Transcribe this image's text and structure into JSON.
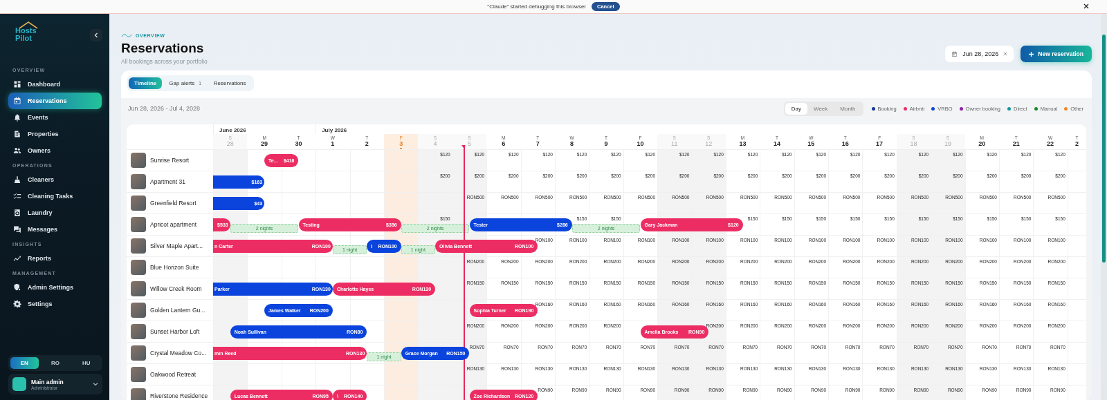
{
  "debug_banner": {
    "message": "\"Claude\" started debugging this browser",
    "action": "Cancel"
  },
  "sidebar": {
    "logo": [
      "Hosts",
      "Pilot"
    ],
    "sections": [
      {
        "title": "OVERVIEW",
        "items": [
          {
            "label": "Dashboard",
            "kind": "dashboard",
            "selected": false
          },
          {
            "label": "Reservations",
            "kind": "calendar",
            "selected": true
          },
          {
            "label": "Events",
            "kind": "bell",
            "selected": false
          },
          {
            "label": "Properties",
            "kind": "building",
            "selected": false
          },
          {
            "label": "Owners",
            "kind": "people",
            "selected": false
          }
        ]
      },
      {
        "title": "OPERATIONS",
        "items": [
          {
            "label": "Cleaners",
            "kind": "cleaner",
            "selected": false
          },
          {
            "label": "Cleaning Tasks",
            "kind": "tasks",
            "selected": false
          },
          {
            "label": "Laundry",
            "kind": "laundry",
            "selected": false
          },
          {
            "label": "Messages",
            "kind": "chat",
            "selected": false
          }
        ]
      },
      {
        "title": "INSIGHTS",
        "items": [
          {
            "label": "Reports",
            "kind": "chart",
            "selected": false
          }
        ]
      },
      {
        "title": "MANAGEMENT",
        "items": [
          {
            "label": "Admin Settings",
            "kind": "admin",
            "selected": false
          },
          {
            "label": "Settings",
            "kind": "gear",
            "selected": false
          }
        ]
      }
    ],
    "languages": [
      {
        "code": "EN",
        "selected": true
      },
      {
        "code": "RO",
        "selected": false
      },
      {
        "code": "HU",
        "selected": false
      }
    ],
    "user": {
      "name": "Main admin",
      "role": "Administrator"
    }
  },
  "header": {
    "eyebrow": "OVERVIEW",
    "title": "Reservations",
    "subtitle": "All bookings across your portfolio",
    "date_filter": "Jun 28, 2026",
    "new_button": "New reservation"
  },
  "tabs": [
    {
      "label": "Timeline",
      "selected": true
    },
    {
      "label": "Gap alerts",
      "badge": "1",
      "selected": false
    },
    {
      "label": "Reservations",
      "selected": false
    }
  ],
  "range": "Jun 28, 2026 - Jul 4, 2028",
  "views": [
    {
      "label": "Day",
      "selected": true
    },
    {
      "label": "Week",
      "selected": false
    },
    {
      "label": "Month",
      "selected": false
    }
  ],
  "legend": [
    {
      "label": "Booking",
      "color": "#1a3597"
    },
    {
      "label": "Airbnb",
      "color": "#ec2d63"
    },
    {
      "label": "VRBO",
      "color": "#0b44dd"
    },
    {
      "label": "Owner booking",
      "color": "#8e1fa8"
    },
    {
      "label": "Direct",
      "color": "#13969a"
    },
    {
      "label": "Manual",
      "color": "#1c8a2a"
    },
    {
      "label": "Other",
      "color": "#ef8a25"
    }
  ],
  "timeline": {
    "days": [
      {
        "month": "June 2026",
        "weekday": "S",
        "day": "28",
        "weekend": true,
        "today": false,
        "now": false
      },
      {
        "weekday": "M",
        "day": "29",
        "weekend": false,
        "today": false,
        "now": false
      },
      {
        "weekday": "T",
        "day": "30",
        "weekend": false,
        "today": false,
        "now": false
      },
      {
        "month": "July 2026",
        "weekday": "W",
        "day": "1",
        "weekend": false,
        "today": false,
        "now": false
      },
      {
        "weekday": "T",
        "day": "2",
        "weekend": false,
        "today": false,
        "now": false
      },
      {
        "weekday": "F",
        "day": "3",
        "weekend": false,
        "today": true,
        "now": false
      },
      {
        "weekday": "S",
        "day": "4",
        "weekend": true,
        "today": false,
        "now": false
      },
      {
        "weekday": "S",
        "day": "5",
        "weekend": true,
        "today": false,
        "now": true
      },
      {
        "weekday": "M",
        "day": "6",
        "weekend": false,
        "today": false,
        "now": false
      },
      {
        "weekday": "T",
        "day": "7",
        "weekend": false,
        "today": false,
        "now": false
      },
      {
        "weekday": "W",
        "day": "8",
        "weekend": false,
        "today": false,
        "now": false
      },
      {
        "weekday": "T",
        "day": "9",
        "weekend": false,
        "today": false,
        "now": false
      },
      {
        "weekday": "F",
        "day": "10",
        "weekend": false,
        "today": false,
        "now": false
      },
      {
        "weekday": "S",
        "day": "11",
        "weekend": true,
        "today": false,
        "now": false
      },
      {
        "weekday": "S",
        "day": "12",
        "weekend": true,
        "today": false,
        "now": false
      },
      {
        "weekday": "M",
        "day": "13",
        "weekend": false,
        "today": false,
        "now": false
      },
      {
        "weekday": "T",
        "day": "14",
        "weekend": false,
        "today": false,
        "now": false
      },
      {
        "weekday": "W",
        "day": "15",
        "weekend": false,
        "today": false,
        "now": false
      },
      {
        "weekday": "T",
        "day": "16",
        "weekend": false,
        "today": false,
        "now": false
      },
      {
        "weekday": "F",
        "day": "17",
        "weekend": false,
        "today": false,
        "now": false
      },
      {
        "weekday": "S",
        "day": "18",
        "weekend": true,
        "today": false,
        "now": false
      },
      {
        "weekday": "S",
        "day": "19",
        "weekend": true,
        "today": false,
        "now": false
      },
      {
        "weekday": "M",
        "day": "20",
        "weekend": false,
        "today": false,
        "now": false
      },
      {
        "weekday": "T",
        "day": "21",
        "weekend": false,
        "today": false,
        "now": false
      },
      {
        "weekday": "W",
        "day": "22",
        "weekend": false,
        "today": false,
        "now": false
      },
      {
        "weekday": "T",
        "day": "2",
        "weekend": false,
        "today": false,
        "now": false
      }
    ],
    "rows": [
      {
        "name": "Sunrise Resort",
        "cells": [
          {
            "kind": "free"
          },
          {
            "kind": "night",
            "booking": {
              "guest": "Te...",
              "amount": "$416",
              "color": "#ec2d63",
              "from_earlier": false
            }
          },
          {
            "kind": "free"
          },
          {
            "kind": "free"
          },
          {
            "kind": "free"
          },
          {
            "kind": "free"
          },
          {
            "kind": "rate",
            "text": "$120"
          },
          {
            "kind": "rate",
            "text": "$120"
          },
          {
            "kind": "rate",
            "text": "$120"
          },
          {
            "kind": "rate",
            "text": "$120"
          },
          {
            "kind": "rate",
            "text": "$120"
          },
          {
            "kind": "rate",
            "text": "$120"
          },
          {
            "kind": "rate",
            "text": "$120"
          },
          {
            "kind": "rate",
            "text": "$120"
          },
          {
            "kind": "rate",
            "text": "$120"
          },
          {
            "kind": "rate",
            "text": "$120"
          },
          {
            "kind": "rate",
            "text": "$120"
          },
          {
            "kind": "rate",
            "text": "$120"
          },
          {
            "kind": "rate",
            "text": "$120"
          },
          {
            "kind": "rate",
            "text": "$120"
          },
          {
            "kind": "rate",
            "text": "$120"
          },
          {
            "kind": "rate",
            "text": "$120"
          },
          {
            "kind": "rate",
            "text": "$120"
          },
          {
            "kind": "rate",
            "text": "$120"
          },
          {
            "kind": "rate",
            "text": "$120"
          },
          {
            "kind": "free"
          }
        ]
      },
      {
        "name": "Apartment 31",
        "cells": [
          {
            "kind": "night",
            "booking": {
              "amount": "$163",
              "color": "#0b44dd",
              "from_earlier": true
            }
          },
          {
            "kind": "free"
          },
          {
            "kind": "free"
          },
          {
            "kind": "free"
          },
          {
            "kind": "free"
          },
          {
            "kind": "free"
          },
          {
            "kind": "rate",
            "text": "$200"
          },
          {
            "kind": "rate",
            "text": "$200"
          },
          {
            "kind": "rate",
            "text": "$200"
          },
          {
            "kind": "rate",
            "text": "$200"
          },
          {
            "kind": "rate",
            "text": "$200"
          },
          {
            "kind": "rate",
            "text": "$200"
          },
          {
            "kind": "rate",
            "text": "$200"
          },
          {
            "kind": "rate",
            "text": "$200"
          },
          {
            "kind": "rate",
            "text": "$200"
          },
          {
            "kind": "rate",
            "text": "$200"
          },
          {
            "kind": "rate",
            "text": "$200"
          },
          {
            "kind": "rate",
            "text": "$200"
          },
          {
            "kind": "rate",
            "text": "$200"
          },
          {
            "kind": "rate",
            "text": "$200"
          },
          {
            "kind": "rate",
            "text": "$200"
          },
          {
            "kind": "rate",
            "text": "$200"
          },
          {
            "kind": "rate",
            "text": "$200"
          },
          {
            "kind": "rate",
            "text": "$200"
          },
          {
            "kind": "rate",
            "text": "$200"
          },
          {
            "kind": "free"
          }
        ]
      },
      {
        "name": "Greenfield Resort",
        "cells": [
          {
            "kind": "night",
            "booking": {
              "amount": "$43",
              "color": "#0b44dd",
              "from_earlier": true
            }
          },
          {
            "kind": "free"
          },
          {
            "kind": "free"
          },
          {
            "kind": "free"
          },
          {
            "kind": "free"
          },
          {
            "kind": "free"
          },
          {
            "kind": "free"
          },
          {
            "kind": "rate",
            "text": "RON500"
          },
          {
            "kind": "rate",
            "text": "RON500"
          },
          {
            "kind": "rate",
            "text": "RON500"
          },
          {
            "kind": "rate",
            "text": "RON500"
          },
          {
            "kind": "rate",
            "text": "RON500"
          },
          {
            "kind": "rate",
            "text": "RON500"
          },
          {
            "kind": "rate",
            "text": "RON500"
          },
          {
            "kind": "rate",
            "text": "RON500"
          },
          {
            "kind": "rate",
            "text": "RON500"
          },
          {
            "kind": "rate",
            "text": "RON500"
          },
          {
            "kind": "rate",
            "text": "RON500"
          },
          {
            "kind": "rate",
            "text": "RON500"
          },
          {
            "kind": "rate",
            "text": "RON500"
          },
          {
            "kind": "rate",
            "text": "RON500"
          },
          {
            "kind": "rate",
            "text": "RON500"
          },
          {
            "kind": "rate",
            "text": "RON500"
          },
          {
            "kind": "rate",
            "text": "RON500"
          },
          {
            "kind": "rate",
            "text": "RON500"
          },
          {
            "kind": "free"
          }
        ]
      },
      {
        "name": "Apricot apartment",
        "cells": [
          {
            "kind": "free",
            "booking": {
              "amount": "$533",
              "color": "#ec2d63",
              "from_earlier": true
            },
            "gap": {
              "label": "2 nights"
            }
          },
          {
            "kind": "free"
          },
          {
            "kind": "night",
            "booking": {
              "guest": "Testing",
              "amount": "$356",
              "color": "#ec2d63",
              "from_earlier": false
            }
          },
          {
            "kind": "night"
          },
          {
            "kind": "night"
          },
          {
            "kind": "free",
            "gap": {
              "label": "2 nights"
            }
          },
          {
            "kind": "rate",
            "text": "$150"
          },
          {
            "kind": "night",
            "booking": {
              "guest": "Tester",
              "amount": "$286",
              "color": "#0b44dd",
              "from_earlier": false
            }
          },
          {
            "kind": "night"
          },
          {
            "kind": "night"
          },
          {
            "kind": "rate",
            "text": "$150",
            "gap": {
              "label": "2 nights"
            }
          },
          {
            "kind": "rate",
            "text": "$150"
          },
          {
            "kind": "night",
            "booking": {
              "guest": "Gary Jackman",
              "amount": "$120",
              "color": "#ec2d63",
              "from_earlier": false
            }
          },
          {
            "kind": "night"
          },
          {
            "kind": "night"
          },
          {
            "kind": "rate",
            "text": "$150"
          },
          {
            "kind": "rate",
            "text": "$150"
          },
          {
            "kind": "rate",
            "text": "$150"
          },
          {
            "kind": "rate",
            "text": "$150"
          },
          {
            "kind": "rate",
            "text": "$150"
          },
          {
            "kind": "rate",
            "text": "$150"
          },
          {
            "kind": "rate",
            "text": "$150"
          },
          {
            "kind": "rate",
            "text": "$150"
          },
          {
            "kind": "rate",
            "text": "$150"
          },
          {
            "kind": "rate",
            "text": "$150"
          },
          {
            "kind": "free"
          }
        ]
      },
      {
        "name": "Silver Maple Apart...",
        "cells": [
          {
            "kind": "night",
            "booking": {
              "guest": "n Carter",
              "amount": "RON100",
              "color": "#ec2d63",
              "from_earlier": true
            }
          },
          {
            "kind": "night"
          },
          {
            "kind": "night"
          },
          {
            "kind": "free",
            "gap": {
              "label": "1 night"
            }
          },
          {
            "kind": "night",
            "booking": {
              "guest": "I",
              "amount": "RON100",
              "color": "#0b44dd",
              "from_earlier": false
            }
          },
          {
            "kind": "free",
            "gap": {
              "label": "1 night"
            }
          },
          {
            "kind": "night",
            "booking": {
              "guest": "Olivia Bennett",
              "amount": "RON100",
              "color": "#ec2d63",
              "from_earlier": false
            }
          },
          {
            "kind": "night"
          },
          {
            "kind": "night"
          },
          {
            "kind": "rate",
            "text": "RON100"
          },
          {
            "kind": "rate",
            "text": "RON100"
          },
          {
            "kind": "rate",
            "text": "RON100"
          },
          {
            "kind": "rate",
            "text": "RON100"
          },
          {
            "kind": "rate",
            "text": "RON100"
          },
          {
            "kind": "rate",
            "text": "RON100"
          },
          {
            "kind": "rate",
            "text": "RON100"
          },
          {
            "kind": "rate",
            "text": "RON100"
          },
          {
            "kind": "rate",
            "text": "RON100"
          },
          {
            "kind": "rate",
            "text": "RON100"
          },
          {
            "kind": "rate",
            "text": "RON100"
          },
          {
            "kind": "rate",
            "text": "RON100"
          },
          {
            "kind": "rate",
            "text": "RON100"
          },
          {
            "kind": "rate",
            "text": "RON100"
          },
          {
            "kind": "rate",
            "text": "RON100"
          },
          {
            "kind": "rate",
            "text": "RON100"
          },
          {
            "kind": "free"
          }
        ]
      },
      {
        "name": "Blue Horizon Suite",
        "cells": [
          {
            "kind": "free"
          },
          {
            "kind": "free"
          },
          {
            "kind": "free"
          },
          {
            "kind": "free"
          },
          {
            "kind": "free"
          },
          {
            "kind": "free"
          },
          {
            "kind": "free"
          },
          {
            "kind": "rate",
            "text": "RON200"
          },
          {
            "kind": "rate",
            "text": "RON200"
          },
          {
            "kind": "rate",
            "text": "RON200"
          },
          {
            "kind": "rate",
            "text": "RON200"
          },
          {
            "kind": "rate",
            "text": "RON200"
          },
          {
            "kind": "rate",
            "text": "RON200"
          },
          {
            "kind": "rate",
            "text": "RON200"
          },
          {
            "kind": "rate",
            "text": "RON200"
          },
          {
            "kind": "rate",
            "text": "RON200"
          },
          {
            "kind": "rate",
            "text": "RON200"
          },
          {
            "kind": "rate",
            "text": "RON200"
          },
          {
            "kind": "rate",
            "text": "RON200"
          },
          {
            "kind": "rate",
            "text": "RON200"
          },
          {
            "kind": "rate",
            "text": "RON200"
          },
          {
            "kind": "rate",
            "text": "RON200"
          },
          {
            "kind": "rate",
            "text": "RON200"
          },
          {
            "kind": "rate",
            "text": "RON200"
          },
          {
            "kind": "rate",
            "text": "RON200"
          },
          {
            "kind": "free"
          }
        ]
      },
      {
        "name": "Willow Creek Room",
        "cells": [
          {
            "kind": "night",
            "booking": {
              "guest": "Parker",
              "amount": "RON130",
              "color": "#0b44dd",
              "from_earlier": true
            }
          },
          {
            "kind": "night"
          },
          {
            "kind": "night"
          },
          {
            "kind": "night",
            "booking": {
              "guest": "Charlotte Hayes",
              "amount": "RON130",
              "color": "#ec2d63",
              "from_earlier": false
            }
          },
          {
            "kind": "night"
          },
          {
            "kind": "night"
          },
          {
            "kind": "free"
          },
          {
            "kind": "rate",
            "text": "RON150"
          },
          {
            "kind": "rate",
            "text": "RON150"
          },
          {
            "kind": "rate",
            "text": "RON150"
          },
          {
            "kind": "rate",
            "text": "RON150"
          },
          {
            "kind": "rate",
            "text": "RON150"
          },
          {
            "kind": "rate",
            "text": "RON150"
          },
          {
            "kind": "rate",
            "text": "RON150"
          },
          {
            "kind": "rate",
            "text": "RON150"
          },
          {
            "kind": "rate",
            "text": "RON150"
          },
          {
            "kind": "rate",
            "text": "RON150"
          },
          {
            "kind": "rate",
            "text": "RON150"
          },
          {
            "kind": "rate",
            "text": "RON150"
          },
          {
            "kind": "rate",
            "text": "RON150"
          },
          {
            "kind": "rate",
            "text": "RON150"
          },
          {
            "kind": "rate",
            "text": "RON150"
          },
          {
            "kind": "rate",
            "text": "RON150"
          },
          {
            "kind": "rate",
            "text": "RON150"
          },
          {
            "kind": "rate",
            "text": "RON150"
          },
          {
            "kind": "free"
          }
        ]
      },
      {
        "name": "Golden Lantern Gu...",
        "cells": [
          {
            "kind": "free"
          },
          {
            "kind": "night",
            "booking": {
              "guest": "James Walker",
              "amount": "RON200",
              "color": "#0b44dd",
              "from_earlier": false
            }
          },
          {
            "kind": "night"
          },
          {
            "kind": "free"
          },
          {
            "kind": "free"
          },
          {
            "kind": "free"
          },
          {
            "kind": "free"
          },
          {
            "kind": "night",
            "booking": {
              "guest": "Sophia Turner",
              "amount": "RON190",
              "color": "#ec2d63",
              "from_earlier": false
            }
          },
          {
            "kind": "night"
          },
          {
            "kind": "rate",
            "text": "RON160"
          },
          {
            "kind": "rate",
            "text": "RON160"
          },
          {
            "kind": "rate",
            "text": "RON160"
          },
          {
            "kind": "rate",
            "text": "RON160"
          },
          {
            "kind": "rate",
            "text": "RON160"
          },
          {
            "kind": "rate",
            "text": "RON160"
          },
          {
            "kind": "rate",
            "text": "RON160"
          },
          {
            "kind": "rate",
            "text": "RON160"
          },
          {
            "kind": "rate",
            "text": "RON160"
          },
          {
            "kind": "rate",
            "text": "RON160"
          },
          {
            "kind": "rate",
            "text": "RON160"
          },
          {
            "kind": "rate",
            "text": "RON160"
          },
          {
            "kind": "rate",
            "text": "RON160"
          },
          {
            "kind": "rate",
            "text": "RON160"
          },
          {
            "kind": "rate",
            "text": "RON160"
          },
          {
            "kind": "rate",
            "text": "RON160"
          },
          {
            "kind": "free"
          }
        ]
      },
      {
        "name": "Sunset Harbor Loft",
        "cells": [
          {
            "kind": "night",
            "booking": {
              "guest": "Noah Sullivan",
              "amount": "RON80",
              "color": "#0b44dd",
              "from_earlier": false
            }
          },
          {
            "kind": "night"
          },
          {
            "kind": "night"
          },
          {
            "kind": "night"
          },
          {
            "kind": "free"
          },
          {
            "kind": "free"
          },
          {
            "kind": "free"
          },
          {
            "kind": "rate",
            "text": "RON200"
          },
          {
            "kind": "rate",
            "text": "RON200"
          },
          {
            "kind": "rate",
            "text": "RON200"
          },
          {
            "kind": "rate",
            "text": "RON200"
          },
          {
            "kind": "rate",
            "text": "RON200"
          },
          {
            "kind": "night",
            "booking": {
              "guest": "Amelia Brooks",
              "amount": "RON90",
              "color": "#ec2d63",
              "from_earlier": false
            }
          },
          {
            "kind": "night"
          },
          {
            "kind": "rate",
            "text": "RON200"
          },
          {
            "kind": "rate",
            "text": "RON200"
          },
          {
            "kind": "rate",
            "text": "RON200"
          },
          {
            "kind": "rate",
            "text": "RON200"
          },
          {
            "kind": "rate",
            "text": "RON200"
          },
          {
            "kind": "rate",
            "text": "RON200"
          },
          {
            "kind": "rate",
            "text": "RON200"
          },
          {
            "kind": "rate",
            "text": "RON200"
          },
          {
            "kind": "rate",
            "text": "RON200"
          },
          {
            "kind": "rate",
            "text": "RON200"
          },
          {
            "kind": "rate",
            "text": "RON200"
          },
          {
            "kind": "free"
          }
        ]
      },
      {
        "name": "Crystal Meadow Co...",
        "cells": [
          {
            "kind": "night",
            "booking": {
              "guest": "min Reed",
              "amount": "RON130",
              "color": "#ec2d63",
              "from_earlier": true
            }
          },
          {
            "kind": "night"
          },
          {
            "kind": "night"
          },
          {
            "kind": "night"
          },
          {
            "kind": "free",
            "gap": {
              "label": "1 night"
            }
          },
          {
            "kind": "night",
            "booking": {
              "guest": "Grace Morgan",
              "amount": "RON150",
              "color": "#0b44dd",
              "from_earlier": false
            }
          },
          {
            "kind": "night"
          },
          {
            "kind": "rate",
            "text": "RON70"
          },
          {
            "kind": "rate",
            "text": "RON70"
          },
          {
            "kind": "rate",
            "text": "RON70"
          },
          {
            "kind": "rate",
            "text": "RON70"
          },
          {
            "kind": "rate",
            "text": "RON70"
          },
          {
            "kind": "rate",
            "text": "RON70"
          },
          {
            "kind": "rate",
            "text": "RON70"
          },
          {
            "kind": "rate",
            "text": "RON70"
          },
          {
            "kind": "rate",
            "text": "RON70"
          },
          {
            "kind": "rate",
            "text": "RON70"
          },
          {
            "kind": "rate",
            "text": "RON70"
          },
          {
            "kind": "rate",
            "text": "RON70"
          },
          {
            "kind": "rate",
            "text": "RON70"
          },
          {
            "kind": "rate",
            "text": "RON70"
          },
          {
            "kind": "rate",
            "text": "RON70"
          },
          {
            "kind": "rate",
            "text": "RON70"
          },
          {
            "kind": "rate",
            "text": "RON70"
          },
          {
            "kind": "rate",
            "text": "RON70"
          },
          {
            "kind": "free"
          }
        ]
      },
      {
        "name": "Oakwood Retreat",
        "cells": [
          {
            "kind": "free"
          },
          {
            "kind": "free"
          },
          {
            "kind": "free"
          },
          {
            "kind": "free"
          },
          {
            "kind": "free"
          },
          {
            "kind": "free"
          },
          {
            "kind": "free"
          },
          {
            "kind": "rate",
            "text": "RON130"
          },
          {
            "kind": "rate",
            "text": "RON130"
          },
          {
            "kind": "rate",
            "text": "RON130"
          },
          {
            "kind": "rate",
            "text": "RON130"
          },
          {
            "kind": "rate",
            "text": "RON130"
          },
          {
            "kind": "rate",
            "text": "RON130"
          },
          {
            "kind": "rate",
            "text": "RON130"
          },
          {
            "kind": "rate",
            "text": "RON130"
          },
          {
            "kind": "rate",
            "text": "RON130"
          },
          {
            "kind": "rate",
            "text": "RON130"
          },
          {
            "kind": "rate",
            "text": "RON130"
          },
          {
            "kind": "rate",
            "text": "RON130"
          },
          {
            "kind": "rate",
            "text": "RON130"
          },
          {
            "kind": "rate",
            "text": "RON130"
          },
          {
            "kind": "rate",
            "text": "RON130"
          },
          {
            "kind": "rate",
            "text": "RON130"
          },
          {
            "kind": "rate",
            "text": "RON130"
          },
          {
            "kind": "rate",
            "text": "RON130"
          },
          {
            "kind": "free"
          }
        ]
      },
      {
        "name": "Riverstone Residence",
        "cells": [
          {
            "kind": "night",
            "booking": {
              "guest": "Lucas Bennett",
              "amount": "RON95",
              "color": "#ec2d63",
              "from_earlier": false
            }
          },
          {
            "kind": "night"
          },
          {
            "kind": "night"
          },
          {
            "kind": "night",
            "booking": {
              "guest": "\\",
              "amount": "RON140",
              "color": "#ec2d63",
              "from_earlier": false
            }
          },
          {
            "kind": "free"
          },
          {
            "kind": "free"
          },
          {
            "kind": "free"
          },
          {
            "kind": "night",
            "booking": {
              "guest": "Zoe Richardson",
              "amount": "RON120",
              "color": "#ec2d63",
              "from_earlier": false
            }
          },
          {
            "kind": "night"
          },
          {
            "kind": "rate",
            "text": "RON90"
          },
          {
            "kind": "rate",
            "text": "RON90"
          },
          {
            "kind": "rate",
            "text": "RON90"
          },
          {
            "kind": "rate",
            "text": "RON90"
          },
          {
            "kind": "rate",
            "text": "RON90"
          },
          {
            "kind": "rate",
            "text": "RON90"
          },
          {
            "kind": "rate",
            "text": "RON90"
          },
          {
            "kind": "rate",
            "text": "RON90"
          },
          {
            "kind": "rate",
            "text": "RON90"
          },
          {
            "kind": "rate",
            "text": "RON90"
          },
          {
            "kind": "rate",
            "text": "RON90"
          },
          {
            "kind": "rate",
            "text": "RON90"
          },
          {
            "kind": "rate",
            "text": "RON90"
          },
          {
            "kind": "rate",
            "text": "RON90"
          },
          {
            "kind": "rate",
            "text": "RON90"
          },
          {
            "kind": "rate",
            "text": "RON90"
          },
          {
            "kind": "free"
          }
        ]
      }
    ]
  }
}
